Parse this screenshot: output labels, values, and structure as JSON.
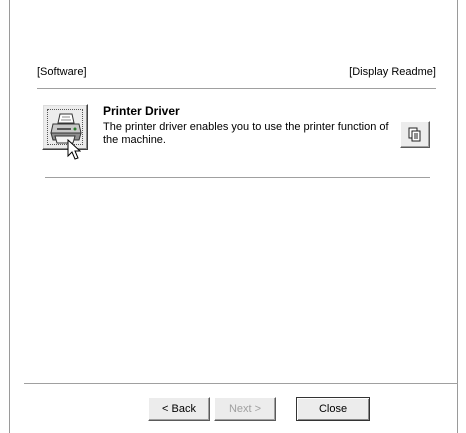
{
  "header": {
    "software_label": "[Software]",
    "readme_label": "[Display Readme]"
  },
  "item": {
    "title": "Printer Driver",
    "description": "The printer driver enables you to use the printer function of the machine.",
    "install_icon": "printer-icon",
    "readme_icon": "document-icon"
  },
  "footer": {
    "back_label": "< Back",
    "next_label": "Next >",
    "close_label": "Close"
  }
}
